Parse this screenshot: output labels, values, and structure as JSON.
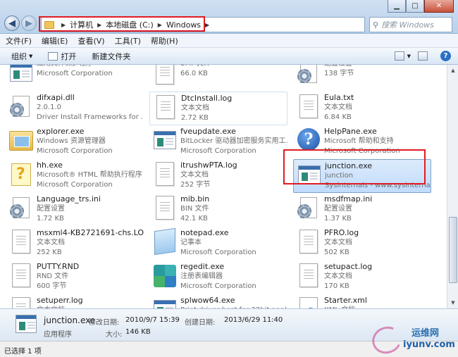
{
  "window": {
    "controls": {
      "minimize": "▁",
      "maximize": "□",
      "close": "✕"
    }
  },
  "address": {
    "back_glyph": "◀",
    "forward_glyph": "▶",
    "crumbs": [
      "计算机",
      "本地磁盘 (C:)",
      "Windows"
    ],
    "sep": "▶",
    "refresh_glyph": "↻"
  },
  "search": {
    "placeholder": "搜索 Windows",
    "icon": "search-icon",
    "glyph": "⚲"
  },
  "menu": [
    "文件(F)",
    "编辑(E)",
    "查看(V)",
    "工具(T)",
    "帮助(H)"
  ],
  "toolbar": {
    "organize": "组织",
    "open": "打开",
    "new_folder": "新建文件夹",
    "dropdown_glyph": "▼",
    "help_glyph": "?"
  },
  "files": [
    {
      "name": "",
      "l2": "应用文件保护程序",
      "l3": "Microsoft Corporation",
      "icon": "exe"
    },
    {
      "name": "",
      "l2": "DAT 文件",
      "l3": "66.0 KB",
      "icon": "doc"
    },
    {
      "name": "",
      "l2": "配置设置",
      "l3": "138 字节",
      "icon": "gear"
    },
    {
      "name": "difxapi.dll",
      "l2": "2.0.1.0",
      "l3": "Driver Install Frameworks for ...",
      "icon": "gear"
    },
    {
      "name": "DtcInstall.log",
      "l2": "文本文档",
      "l3": "2.72 KB",
      "icon": "doc",
      "hover": true
    },
    {
      "name": "Eula.txt",
      "l2": "文本文档",
      "l3": "6.84 KB",
      "icon": "doc"
    },
    {
      "name": "explorer.exe",
      "l2": "Windows 资源管理器",
      "l3": "Microsoft Corporation",
      "icon": "folder"
    },
    {
      "name": "fveupdate.exe",
      "l2": "BitLocker 驱动器加密服务实用工...",
      "l3": "Microsoft Corporation",
      "icon": "exe"
    },
    {
      "name": "HelpPane.exe",
      "l2": "Microsoft 帮助和支持",
      "l3": "Microsoft Corporation",
      "icon": "help"
    },
    {
      "name": "hh.exe",
      "l2": "Microsoft® HTML 帮助执行程序",
      "l3": "Microsoft Corporation",
      "icon": "chm"
    },
    {
      "name": "itrushwPTA.log",
      "l2": "文本文档",
      "l3": "252 字节",
      "icon": "doc"
    },
    {
      "name": "junction.exe",
      "l2": "junction",
      "l3": "Sysinternals - www.sysinternals...",
      "icon": "exe",
      "selected": true
    },
    {
      "name": "Language_trs.ini",
      "l2": "配置设置",
      "l3": "1.72 KB",
      "icon": "gear"
    },
    {
      "name": "mib.bin",
      "l2": "BIN 文件",
      "l3": "42.1 KB",
      "icon": "doc"
    },
    {
      "name": "msdfmap.ini",
      "l2": "配置设置",
      "l3": "1.37 KB",
      "icon": "gear"
    },
    {
      "name": "msxml4-KB2721691-chs.LOG",
      "l2": "文本文档",
      "l3": "252 KB",
      "icon": "doc"
    },
    {
      "name": "notepad.exe",
      "l2": "记事本",
      "l3": "Microsoft Corporation",
      "icon": "notepad"
    },
    {
      "name": "PFRO.log",
      "l2": "文本文档",
      "l3": "502 KB",
      "icon": "doc"
    },
    {
      "name": "PUTTY.RND",
      "l2": "RND 文件",
      "l3": "600 字节",
      "icon": "doc"
    },
    {
      "name": "regedit.exe",
      "l2": "注册表编辑器",
      "l3": "Microsoft Corporation",
      "icon": "regedit"
    },
    {
      "name": "setupact.log",
      "l2": "文本文档",
      "l3": "170 KB",
      "icon": "doc"
    },
    {
      "name": "setuperr.log",
      "l2": "文本文档",
      "l3": "0 字节",
      "icon": "doc"
    },
    {
      "name": "splwow64.exe",
      "l2": "Print driver host for 32bit appl...",
      "l3": "Microsoft Corporation",
      "icon": "exe"
    },
    {
      "name": "Starter.xml",
      "l2": "XML 文档",
      "l3": "40.0 KB",
      "icon": "xml"
    }
  ],
  "scroll": {
    "up": "▲",
    "down": "▼"
  },
  "details": {
    "name": "junction.exe",
    "type": "应用程序",
    "modified_label": "修改日期:",
    "modified_value": "2010/9/7 15:39",
    "size_label": "大小:",
    "size_value": "146 KB",
    "created_label": "创建日期:",
    "created_value": "2013/6/29 11:40"
  },
  "status": {
    "text": "已选择 1 项"
  },
  "watermark": {
    "line1": "运维网",
    "line2": "iyunv.com"
  }
}
